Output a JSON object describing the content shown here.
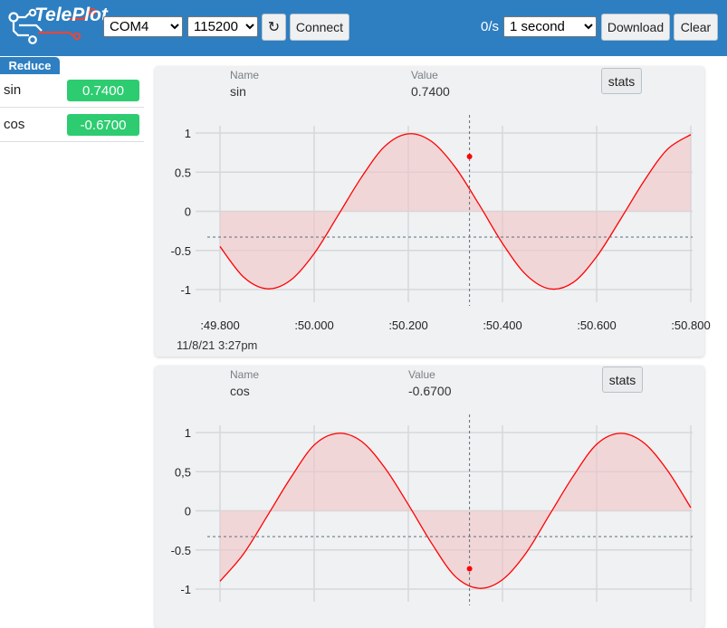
{
  "app": {
    "logo_text": "TeleP",
    "logo_text_tail": "lot",
    "port": {
      "selected": "COM4"
    },
    "baud": {
      "selected": "115200"
    },
    "refresh_icon": "↻",
    "connect_label": "Connect",
    "rate_text": "0/s",
    "window": {
      "selected": "1 second"
    },
    "download_label": "Download",
    "clear_label": "Clear"
  },
  "sidebar": {
    "reduce_label": "Reduce",
    "variables": [
      {
        "name": "sin",
        "value": "0.7400",
        "badge_color": "#2dcc70"
      },
      {
        "name": "cos",
        "value": "-0.6700",
        "badge_color": "#2dcc70"
      }
    ]
  },
  "panels": [
    {
      "name_label": "Name",
      "name": "sin",
      "value_label": "Value",
      "value": "0.7400",
      "stats_label": "stats",
      "timestamp": "11/8/21 3:27pm"
    },
    {
      "name_label": "Name",
      "name": "cos",
      "value_label": "Value",
      "value": "-0.6700",
      "stats_label": "stats",
      "timestamp": ""
    }
  ],
  "chart_data": [
    {
      "type": "area",
      "series": [
        {
          "name": "sin",
          "color": "#ff0000",
          "fill": "#f2c4c6",
          "x": [
            49.8,
            49.85,
            49.9,
            49.95,
            50.0,
            50.05,
            50.1,
            50.15,
            50.2,
            50.25,
            50.3,
            50.35,
            50.4,
            50.45,
            50.5,
            50.55,
            50.6,
            50.65,
            50.7,
            50.75,
            50.8
          ],
          "y": [
            -0.45,
            -0.84,
            -0.99,
            -0.88,
            -0.54,
            -0.06,
            0.43,
            0.83,
            0.99,
            0.89,
            0.56,
            0.09,
            -0.41,
            -0.81,
            -0.99,
            -0.91,
            -0.58,
            -0.11,
            0.38,
            0.79,
            0.98
          ]
        }
      ],
      "xtick_labels": [
        ":49.800",
        ":50.000",
        ":50.200",
        ":50.400",
        ":50.600",
        ":50.800"
      ],
      "xticks": [
        49.8,
        50.0,
        50.2,
        50.4,
        50.6,
        50.8
      ],
      "ytick_labels": [
        "1",
        "0.5",
        "0",
        "-0.5",
        "-1"
      ],
      "yticks": [
        1,
        0.5,
        0,
        -0.5,
        -1
      ],
      "xlim": [
        49.78,
        50.81
      ],
      "ylim": [
        -1.2,
        1.2
      ],
      "cursor": {
        "x": 50.33,
        "y": 0.7,
        "hline": -0.33
      },
      "grid": true
    },
    {
      "type": "area",
      "series": [
        {
          "name": "cos",
          "color": "#ff0000",
          "fill": "#f2c4c6",
          "x": [
            49.8,
            49.85,
            49.9,
            49.95,
            50.0,
            50.05,
            50.1,
            50.15,
            50.2,
            50.25,
            50.3,
            50.35,
            50.4,
            50.45,
            50.5,
            50.55,
            50.6,
            50.65,
            50.7,
            50.75,
            50.8
          ],
          "y": [
            -0.9,
            -0.55,
            -0.07,
            0.42,
            0.84,
            0.99,
            0.89,
            0.55,
            0.08,
            -0.42,
            -0.84,
            -0.99,
            -0.88,
            -0.54,
            -0.05,
            0.44,
            0.85,
            0.99,
            0.87,
            0.52,
            0.04
          ]
        }
      ],
      "xtick_labels": [],
      "xticks": [
        49.8,
        50.0,
        50.2,
        50.4,
        50.6,
        50.8
      ],
      "ytick_labels": [
        "1",
        "0,5",
        "0",
        "-0.5",
        "-1"
      ],
      "yticks": [
        1,
        0.5,
        0,
        -0.5,
        -1
      ],
      "xlim": [
        49.78,
        50.81
      ],
      "ylim": [
        -1.2,
        1.2
      ],
      "cursor": {
        "x": 50.33,
        "y": -0.74,
        "hline": -0.33
      },
      "grid": true
    }
  ]
}
